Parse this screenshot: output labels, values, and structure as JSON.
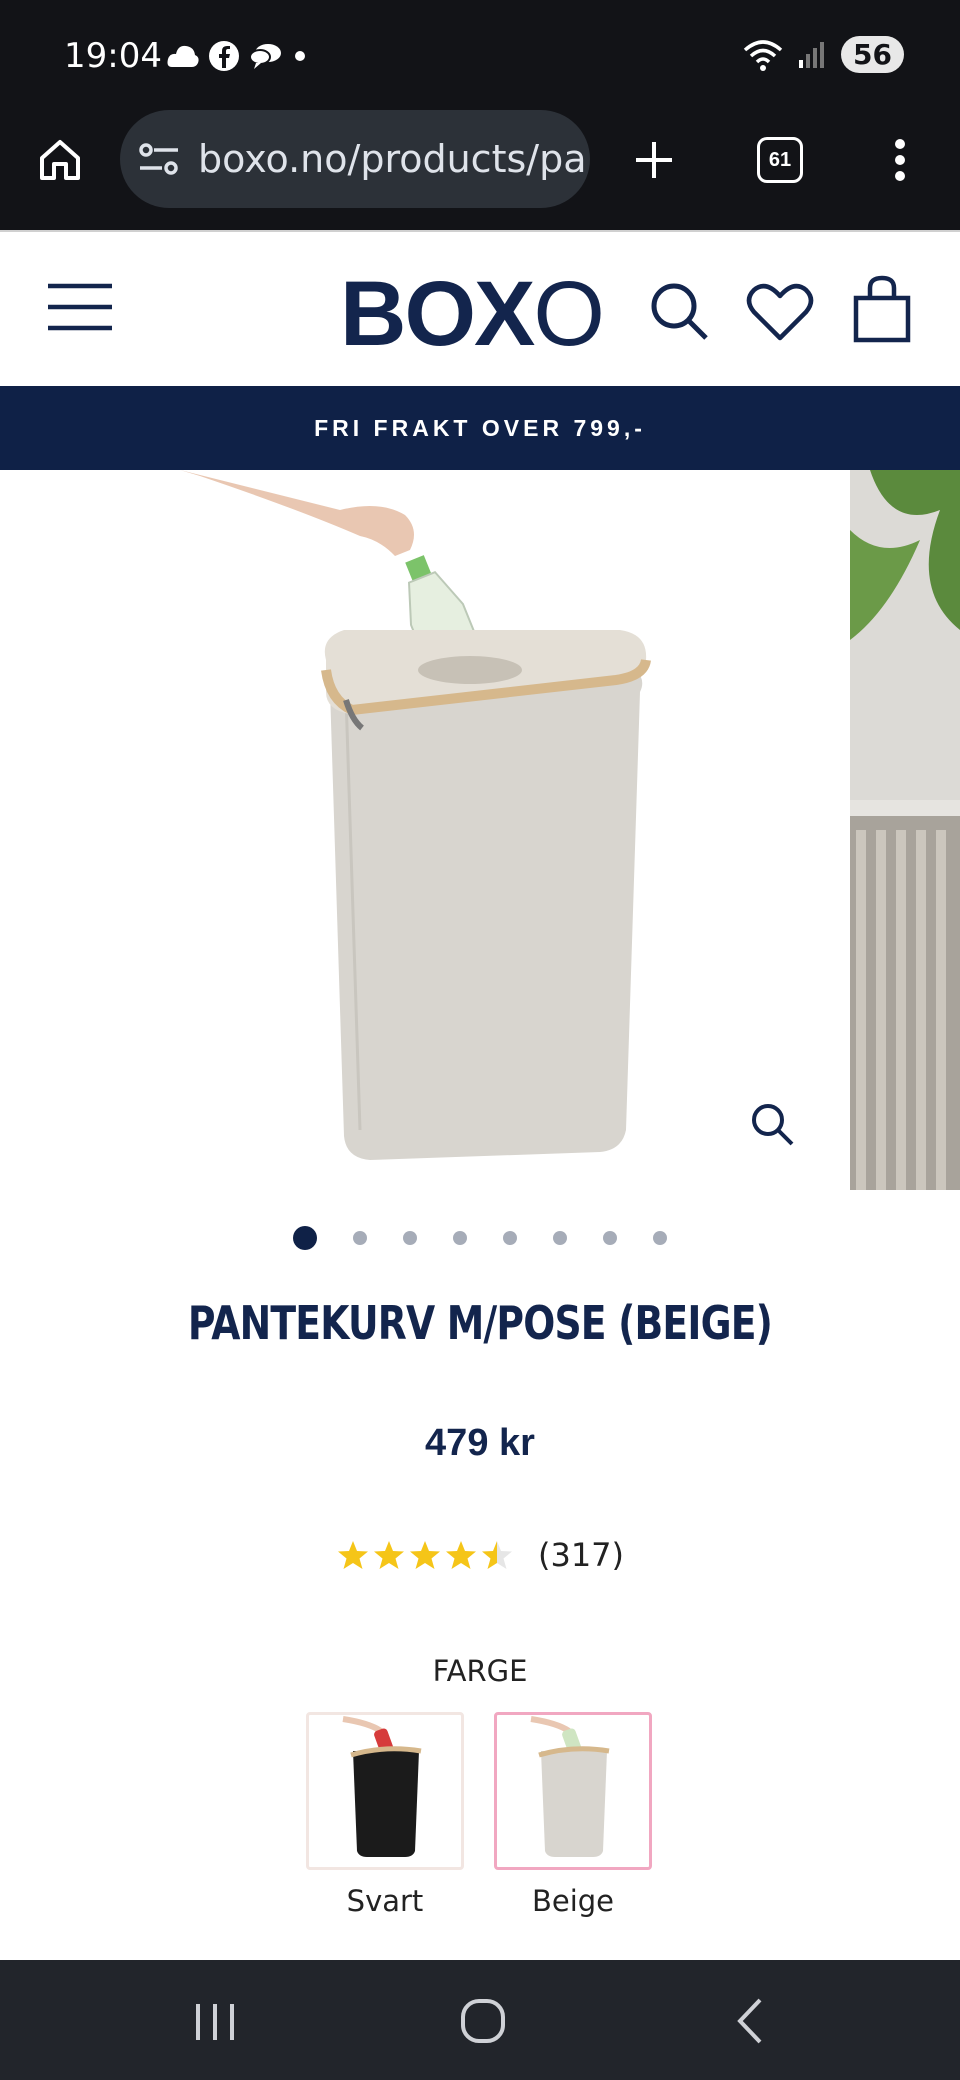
{
  "status_bar": {
    "time": "19:04",
    "battery": "56"
  },
  "browser": {
    "url": "boxo.no/products/pa",
    "tab_count": "61"
  },
  "site": {
    "logo": "BOXO",
    "banner": "FRI FRAKT OVER 799,-"
  },
  "gallery": {
    "slide_count": 8,
    "active_slide": 1
  },
  "product": {
    "title": "PANTEKURV M/POSE (BEIGE)",
    "price": "479 kr",
    "rating": 4.5,
    "review_count": "(317)",
    "color_label": "FARGE",
    "swatches": [
      {
        "label": "Svart",
        "selected": false
      },
      {
        "label": "Beige",
        "selected": true
      }
    ]
  },
  "colors": {
    "navy": "#0f2147",
    "star": "#f5c518",
    "selected_border": "#f1a7c1"
  }
}
